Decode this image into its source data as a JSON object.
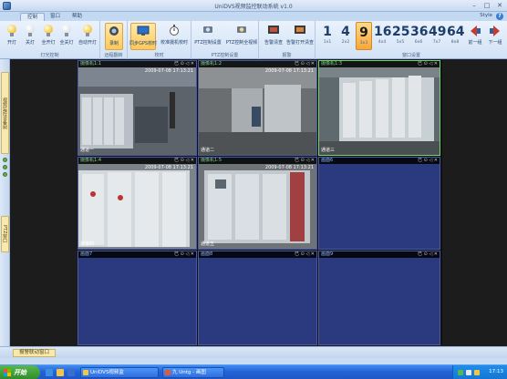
{
  "window": {
    "title": "UniDVS视频监控联动系统 v1.0",
    "minimize": "–",
    "maximize": "□",
    "close": "✕"
  },
  "tabs": [
    "控制",
    "窗口",
    "帮助"
  ],
  "style_label": "Style",
  "help_icon_label": "?",
  "ribbon": {
    "light_group": {
      "label": "灯光控制",
      "buttons": [
        "开灯",
        "关灯",
        "全开灯",
        "全关灯",
        "自动开灯"
      ]
    },
    "record_group": {
      "label": "远程翻转",
      "buttons": [
        "录制"
      ]
    },
    "sync_group": {
      "label": "校时",
      "buttons": [
        "同步GPS校时",
        "校准摄机校时"
      ]
    },
    "ptz_group": {
      "label": "PTZ控制设置",
      "buttons": [
        "PTZ控制设置",
        "PTZ控制全视频"
      ]
    },
    "alarm_group": {
      "label": "报警",
      "buttons": [
        "告警清查",
        "告警打开清查"
      ]
    },
    "screen_group": {
      "label": "窗口设置",
      "layouts": [
        {
          "n": "1",
          "s": "1x1"
        },
        {
          "n": "4",
          "s": "2x2"
        },
        {
          "n": "9",
          "s": "3x3"
        },
        {
          "n": "16",
          "s": "4x4"
        },
        {
          "n": "25",
          "s": "5x5"
        },
        {
          "n": "36",
          "s": "6x6"
        },
        {
          "n": "49",
          "s": "7x7"
        },
        {
          "n": "64",
          "s": "8x8"
        }
      ],
      "prev_label": "前一组",
      "next_label": "下一组"
    }
  },
  "left_toolbar": {
    "top_tab": "视频监控设备树",
    "bottom_tab": "PTZ窗口"
  },
  "video_cells": [
    {
      "name": "摄像机1:1",
      "timestamp": "2009-07-08 17:13:21",
      "footer": "通道一",
      "color": "green"
    },
    {
      "name": "摄像机1:2",
      "timestamp": "2009-07-08 17:13:21",
      "footer": "通道二",
      "color": "green"
    },
    {
      "name": "摄像机1:3",
      "timestamp": "",
      "footer": "通道三",
      "color": "green"
    },
    {
      "name": "摄像机1:4",
      "timestamp": "2009-07-08 17:13:21",
      "footer": "通道四",
      "color": "green"
    },
    {
      "name": "摄像机1:5",
      "timestamp": "2009-07-08 17:13:21",
      "footer": "通道五",
      "color": "green"
    },
    {
      "name": "画面6",
      "timestamp": "",
      "footer": "",
      "color": "blue"
    },
    {
      "name": "画面7",
      "timestamp": "",
      "footer": "",
      "color": "blue"
    },
    {
      "name": "画面8",
      "timestamp": "",
      "footer": "",
      "color": "blue"
    },
    {
      "name": "画面9",
      "timestamp": "",
      "footer": "",
      "color": "blue"
    }
  ],
  "cell_icons": "已 ⊙ ◁ ✕",
  "status_tab": "报警联动窗口",
  "taskbar": {
    "start": "开始",
    "apps": [
      "UniDVS视频监",
      "九 Untg - 画图"
    ],
    "clock": "17:13"
  },
  "colors": {
    "accent": "#ffc85a",
    "cell_empty": "#2b3a7e",
    "taskbar": "#2563d6"
  }
}
